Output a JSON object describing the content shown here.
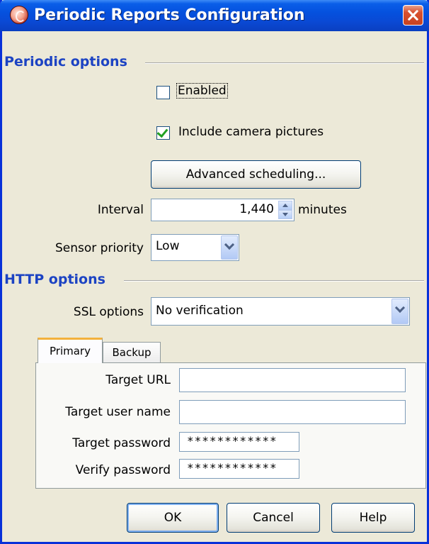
{
  "window": {
    "title": "Periodic Reports Configuration",
    "app_icon": "app-logo-icon",
    "close_icon": "close-icon"
  },
  "periodic": {
    "section_title": "Periodic options",
    "enabled_label": "Enabled",
    "enabled_checked": false,
    "camera_label": "Include camera pictures",
    "camera_checked": true,
    "advanced_label": "Advanced scheduling...",
    "interval_label": "Interval",
    "interval_value": "1,440",
    "interval_unit": "minutes",
    "sensor_priority_label": "Sensor priority",
    "sensor_priority_value": "Low"
  },
  "http": {
    "section_title": "HTTP options",
    "ssl_label": "SSL options",
    "ssl_value": "No verification",
    "tabs": [
      {
        "label": "Primary",
        "active": true
      },
      {
        "label": "Backup",
        "active": false
      }
    ],
    "target_url_label": "Target URL",
    "target_url_value": "",
    "target_user_label": "Target user name",
    "target_user_value": "",
    "target_password_label": "Target password",
    "target_password_value": "************",
    "verify_password_label": "Verify password",
    "verify_password_value": "************"
  },
  "buttons": {
    "ok": "OK",
    "cancel": "Cancel",
    "help": "Help"
  },
  "colors": {
    "title_bar": "#0a5ee8",
    "section_title": "#1c43c3",
    "background": "#ece9d8",
    "close_button": "#d9502f",
    "checkmark": "#21a121",
    "active_tab_accent": "#f3b13d"
  }
}
